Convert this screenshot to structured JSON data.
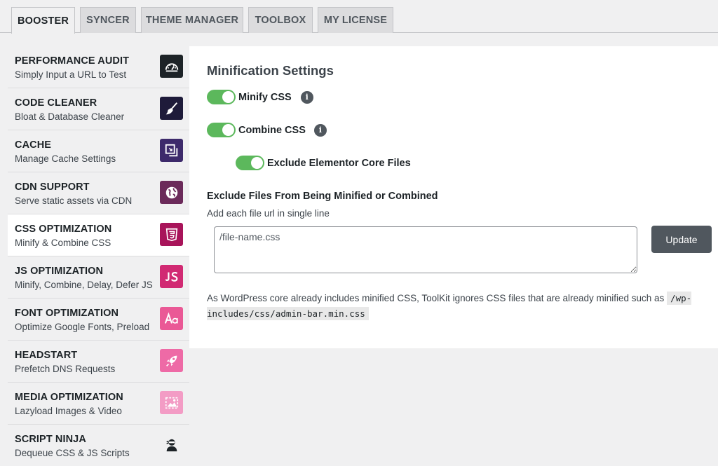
{
  "tabs": [
    {
      "label": "BOOSTER"
    },
    {
      "label": "SYNCER"
    },
    {
      "label": "THEME MANAGER"
    },
    {
      "label": "TOOLBOX"
    },
    {
      "label": "MY LICENSE"
    }
  ],
  "sidebar": {
    "items": [
      {
        "title": "PERFORMANCE AUDIT",
        "subtitle": "Simply Input a URL to Test",
        "icon": "speedometer-icon",
        "color": "#1d2327"
      },
      {
        "title": "CODE CLEANER",
        "subtitle": "Bloat & Database Cleaner",
        "icon": "broom-icon",
        "color": "#1e1b3a"
      },
      {
        "title": "CACHE",
        "subtitle": "Manage Cache Settings",
        "icon": "cache-icon",
        "color": "#3d2a6b"
      },
      {
        "title": "CDN SUPPORT",
        "subtitle": "Serve static assets via CDN",
        "icon": "globe-icon",
        "color": "#6b2a5a"
      },
      {
        "title": "CSS OPTIMIZATION",
        "subtitle": "Minify & Combine CSS",
        "icon": "css3-icon",
        "color": "#a8145a"
      },
      {
        "title": "JS OPTIMIZATION",
        "subtitle": "Minify, Combine, Delay, Defer JS",
        "icon": "js-icon",
        "color": "#d12a73"
      },
      {
        "title": "FONT OPTIMIZATION",
        "subtitle": "Optimize Google Fonts, Preload",
        "icon": "font-icon",
        "color": "#ea5996"
      },
      {
        "title": "HEADSTART",
        "subtitle": "Prefetch DNS Requests",
        "icon": "rocket-icon",
        "color": "#ee6aa6"
      },
      {
        "title": "MEDIA OPTIMIZATION",
        "subtitle": "Lazyload Images & Video",
        "icon": "image-icon",
        "color": "#f39cc5"
      },
      {
        "title": "SCRIPT NINJA",
        "subtitle": "Dequeue CSS & JS Scripts",
        "icon": "ninja-icon",
        "color": "#f0f0f1"
      }
    ]
  },
  "main": {
    "title": "Minification Settings",
    "toggles": {
      "minify_css": {
        "label": "Minify CSS",
        "enabled": true
      },
      "combine_css": {
        "label": "Combine CSS",
        "enabled": true
      },
      "exclude_elementor": {
        "label": "Exclude Elementor Core Files",
        "enabled": true
      }
    },
    "info_glyph": "i",
    "exclude": {
      "title": "Exclude Files From Being Minified or Combined",
      "hint": "Add each file url in single line",
      "placeholder": "/file-name.css",
      "value": ""
    },
    "update_label": "Update",
    "note_text": "As WordPress core already includes minified CSS, ToolKit ignores CSS files that are already minified such as",
    "note_code": "/wp-includes/css/admin-bar.min.css"
  },
  "colors": {
    "toggle_on": "#5cb85c",
    "button_bg": "#50575e",
    "page_bg": "#f0f0f1"
  }
}
